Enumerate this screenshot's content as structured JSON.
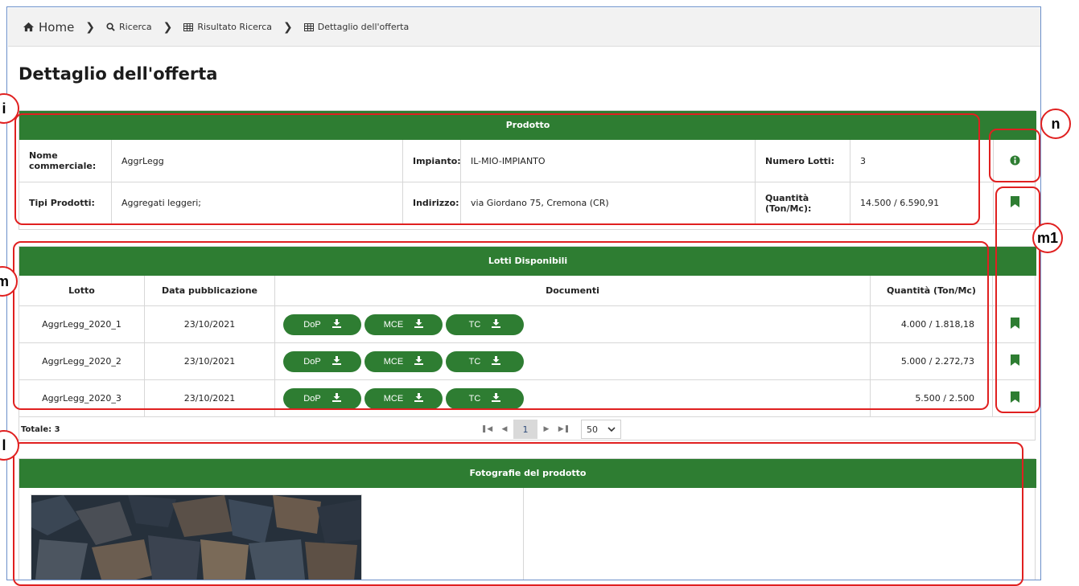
{
  "breadcrumb": {
    "home": "Home",
    "items": [
      "Ricerca",
      "Risultato Ricerca",
      "Dettaglio dell'offerta"
    ]
  },
  "page": {
    "title": "Dettaglio dell'offerta"
  },
  "prodotto": {
    "header": "Prodotto",
    "nome_label": "Nome commerciale:",
    "nome_value": "AggrLegg",
    "impianto_label": "Impianto:",
    "impianto_value": "IL-MIO-IMPIANTO",
    "numero_lotti_label": "Numero Lotti:",
    "numero_lotti_value": "3",
    "tipi_label": "Tipi Prodotti:",
    "tipi_value": "Aggregati leggeri;",
    "indirizzo_label": "Indirizzo:",
    "indirizzo_value": "via Giordano 75, Cremona (CR)",
    "quantita_label": "Quantità (Ton/Mc):",
    "quantita_value": "14.500 / 6.590,91"
  },
  "lotti": {
    "header": "Lotti Disponibili",
    "columns": [
      "Lotto",
      "Data pubblicazione",
      "Documenti",
      "Quantità (Ton/Mc)"
    ],
    "doc_buttons": [
      "DoP",
      "MCE",
      "TC"
    ],
    "rows": [
      {
        "lotto": "AggrLegg_2020_1",
        "data": "23/10/2021",
        "quantita": "4.000 / 1.818,18"
      },
      {
        "lotto": "AggrLegg_2020_2",
        "data": "23/10/2021",
        "quantita": "5.000 / 2.272,73"
      },
      {
        "lotto": "AggrLegg_2020_3",
        "data": "23/10/2021",
        "quantita": "5.500 / 2.500"
      }
    ],
    "totale": "Totale: 3",
    "current_page": "1",
    "per_page": "50"
  },
  "foto": {
    "header": "Fotografie del prodotto"
  },
  "annotations": [
    "i",
    "n",
    "m1",
    "m",
    "l"
  ],
  "colors": {
    "accent": "#2e7d32",
    "annotation": "#e02020"
  }
}
